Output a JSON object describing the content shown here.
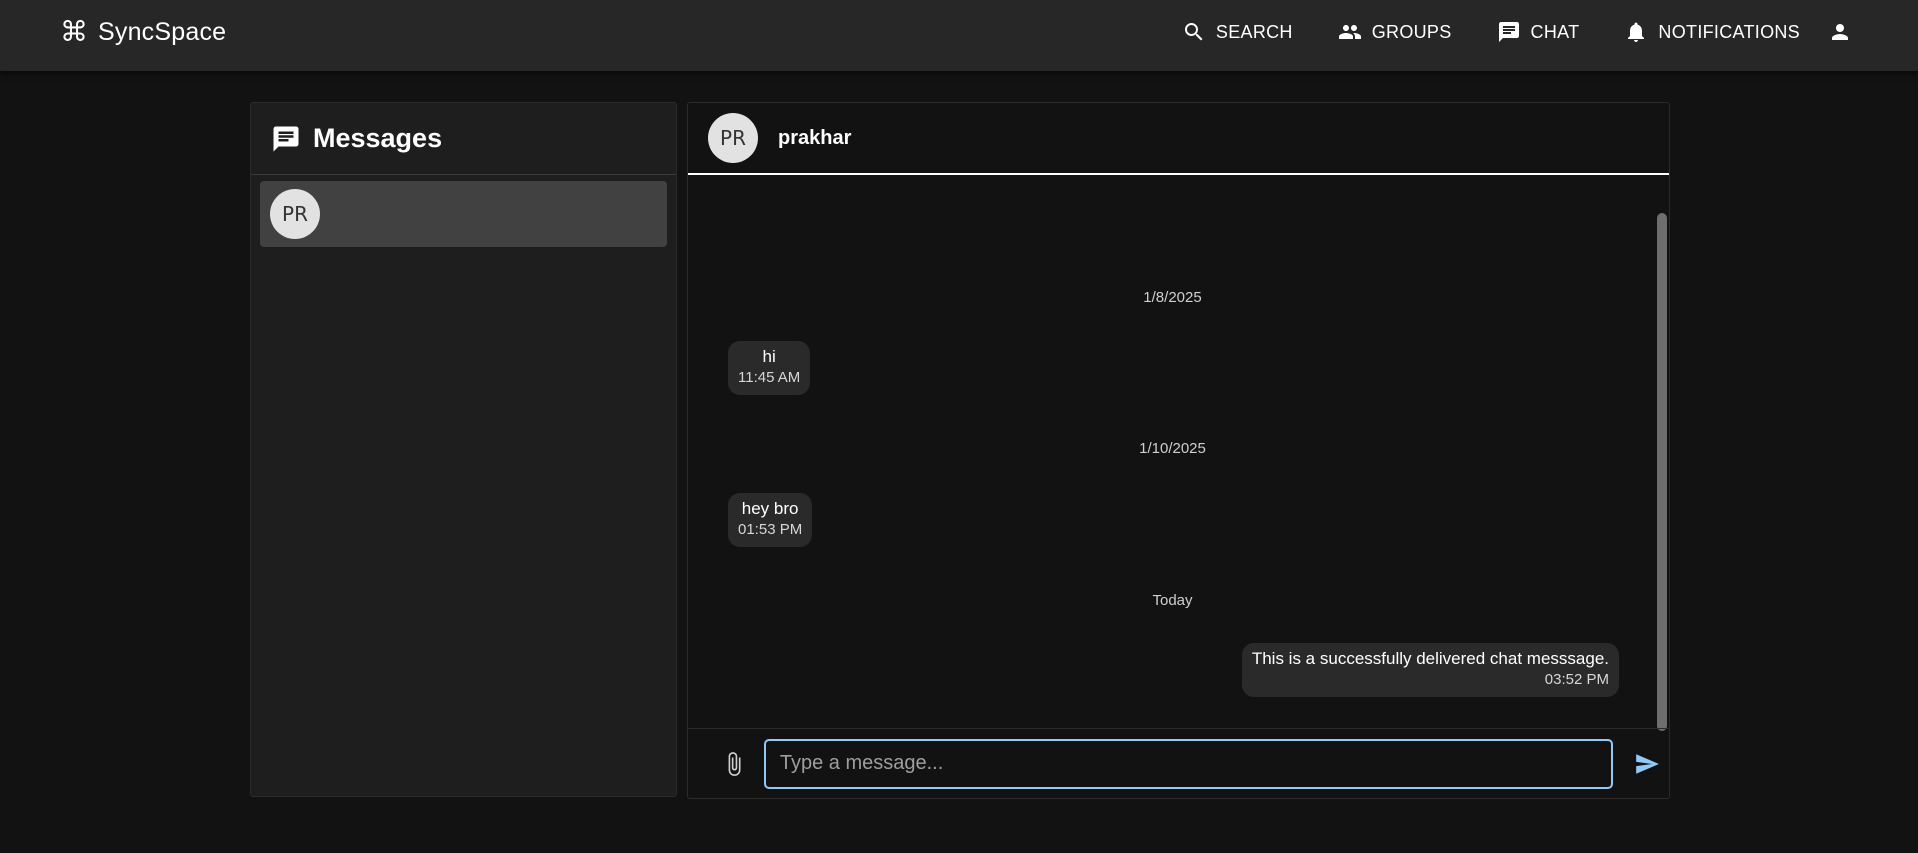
{
  "app": {
    "title": "SyncSpace",
    "logo_icon": "command-icon"
  },
  "nav": {
    "items": [
      {
        "label": "SEARCH",
        "icon": "search-icon"
      },
      {
        "label": "GROUPS",
        "icon": "groups-icon"
      },
      {
        "label": "CHAT",
        "icon": "chat-icon"
      },
      {
        "label": "NOTIFICATIONS",
        "icon": "bell-icon"
      }
    ],
    "profile_icon": "person-icon"
  },
  "sidebar": {
    "title": "Messages",
    "icon": "chat-icon",
    "conversations": [
      {
        "avatar_initials": "PR",
        "selected": true
      }
    ]
  },
  "chat": {
    "contact": {
      "name": "prakhar",
      "avatar_initials": "PR"
    },
    "groups": [
      {
        "date": "1/8/2025",
        "messages": [
          {
            "text": "hi",
            "time": "11:45 AM",
            "direction": "received"
          }
        ]
      },
      {
        "date": "1/10/2025",
        "messages": [
          {
            "text": "hey bro",
            "time": "01:53 PM",
            "direction": "received"
          }
        ]
      },
      {
        "date": "Today",
        "messages": [
          {
            "text": "This is a successfully delivered chat messsage.",
            "time": "03:52 PM",
            "direction": "sent"
          }
        ]
      }
    ],
    "composer": {
      "placeholder": "Type a message...",
      "value": "",
      "attach_icon": "paperclip-icon",
      "send_icon": "send-icon"
    }
  },
  "colors": {
    "background": "#121212",
    "appbar": "#272727",
    "panel": "#1e1e1e",
    "selected_item": "#414141",
    "bubble": "#2a2a2a",
    "accent": "#90caf9"
  }
}
